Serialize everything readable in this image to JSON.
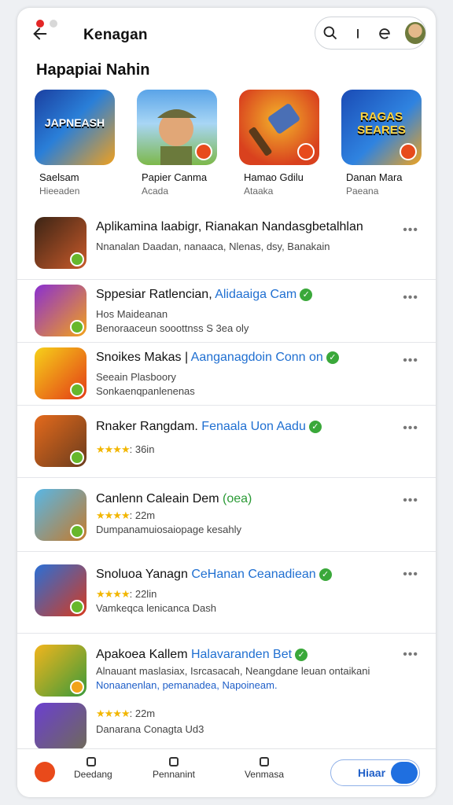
{
  "header": {
    "title": "Kenagan"
  },
  "toolbar": {
    "search_icon": "search-icon",
    "info_icon": "info-icon",
    "settings_icon": "settings-icon"
  },
  "section": {
    "title": "Hapapiai Nahin"
  },
  "featured": [
    {
      "name": "Saelsam",
      "sub": "Hieeaden",
      "logo": "JAPNEASH",
      "colors": [
        "#1b3fa0",
        "#f0a01e"
      ]
    },
    {
      "name": "Papier Canma",
      "sub": "Acada",
      "logo": "",
      "colors": [
        "#5aa4e8",
        "#7db84a"
      ]
    },
    {
      "name": "Hamao Gdilu",
      "sub": "Ataaka",
      "logo": "",
      "colors": [
        "#f3b52b",
        "#d9411e"
      ]
    },
    {
      "name": "Danan Mara",
      "sub": "Paeana",
      "logo": "RAGAS SEARES",
      "colors": [
        "#1a4bb5",
        "#f0a31e"
      ]
    }
  ],
  "list": [
    {
      "title": "Aplikamina laabigr, Rianakan Nandasgbetalhlan",
      "publisher": "",
      "verified": false,
      "line2": "Nnanalan Daadan, nanaaca, Nlenas, dsy, Banakain",
      "line3": "",
      "rating": "",
      "colors": [
        "#3b2415",
        "#c95a2a"
      ]
    },
    {
      "title": "Sppesiar Ratlencian,",
      "publisher": "Alidaaiga Cam",
      "verified": true,
      "line2": "Hos Maideanan",
      "line3": "Benoraaceun sooottnss S 3ea oly",
      "rating": "",
      "colors": [
        "#8a2fd1",
        "#f3a21a"
      ]
    },
    {
      "title": "Snoikes Makas |",
      "publisher": "Aanganagdoin Conn on",
      "verified": true,
      "line2": "Seeain Plasboory",
      "line3": "Sonkaenqpanlenenas",
      "rating": "",
      "colors": [
        "#f6d11a",
        "#e33b16"
      ]
    },
    {
      "title": "Rnaker Rangdam.",
      "publisher": "Fenaala Uon Aadu",
      "verified": true,
      "line2": "",
      "line3": "",
      "rating": ": 36in",
      "colors": [
        "#e46a1c",
        "#6b3c1d"
      ]
    },
    {
      "title": "Canlenn Caleain Dem",
      "publisher": "(oea)",
      "verified": false,
      "line2": "",
      "line3": "Dumpanamuiosaiopage kesahly",
      "rating": ": 22m",
      "colors": [
        "#58b7e6",
        "#c57a2b"
      ]
    },
    {
      "title": "Snoluoa Yanagn",
      "publisher": "CeHanan Ceanadiean",
      "verified": true,
      "line2": "",
      "line3": "Vamkeqca lenicanca Dash",
      "rating": ": 22lin",
      "colors": [
        "#2a6fd6",
        "#d63a1f"
      ]
    },
    {
      "title": "Apakoea Kallem",
      "publisher": "Halavaranden Bet",
      "verified": true,
      "line2": "Alnauant maslasiax, Isrcasacah, Neangdane leuan ontaikani",
      "line3": "Nonaanenlan, pemanadea, Napoineam.",
      "rating": "",
      "colors": [
        "#f2b51d",
        "#3b9a3a"
      ]
    },
    {
      "title": "",
      "publisher": "",
      "verified": false,
      "line2": "",
      "line3": "Danarana Conagta Ud3",
      "rating": ": 22m",
      "colors": [
        "#6b3fd0",
        "#6f6a5a"
      ]
    }
  ],
  "nav": {
    "item1": "Deedang",
    "item2": "Pennanint",
    "item3": "Venmasa",
    "pill_label": "Hiaar"
  }
}
